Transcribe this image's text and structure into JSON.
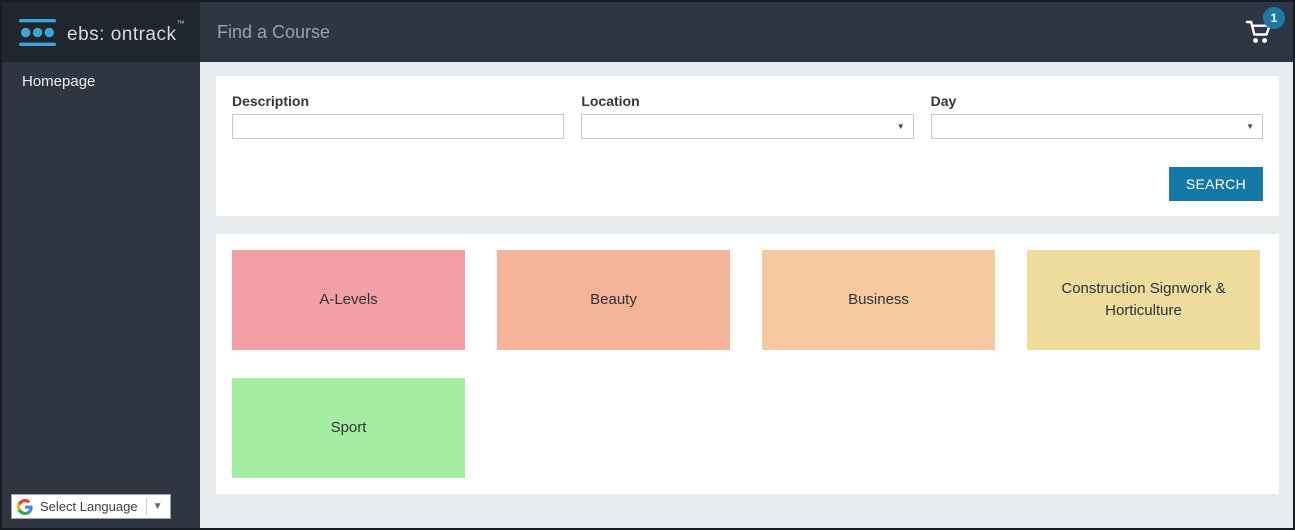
{
  "header": {
    "logo": {
      "text": "ebs: ontrack",
      "trademark": "™"
    },
    "title": "Find a Course",
    "cart": {
      "badge_count": "1"
    }
  },
  "sidebar": {
    "items": [
      {
        "label": "Homepage"
      }
    ],
    "language": {
      "label": "Select Language",
      "arrow": "▼"
    }
  },
  "search_form": {
    "fields": [
      {
        "label": "Description",
        "type": "text",
        "value": "",
        "placeholder": ""
      },
      {
        "label": "Location",
        "type": "select",
        "value": ""
      },
      {
        "label": "Day",
        "type": "select",
        "value": ""
      }
    ],
    "select_arrow": "▼",
    "search_label": "SEARCH"
  },
  "categories": [
    {
      "label": "A-Levels",
      "color": "#f2a0a6"
    },
    {
      "label": "Beauty",
      "color": "#f5b399"
    },
    {
      "label": "Business",
      "color": "#f7c9a0"
    },
    {
      "label": "Construction Signwork & Horticulture",
      "color": "#eedd9c"
    },
    {
      "label": "Sport",
      "color": "#a4eda3"
    }
  ],
  "colors": {
    "accent": "#1579a8",
    "badge": "#1b7ba6",
    "logo_block_bg": "#20262d",
    "header_bg": "#2d3744",
    "sidebar_bg": "#2f3642",
    "content_bg": "#e8ebee",
    "logo_blue": "#3aa7d9"
  }
}
